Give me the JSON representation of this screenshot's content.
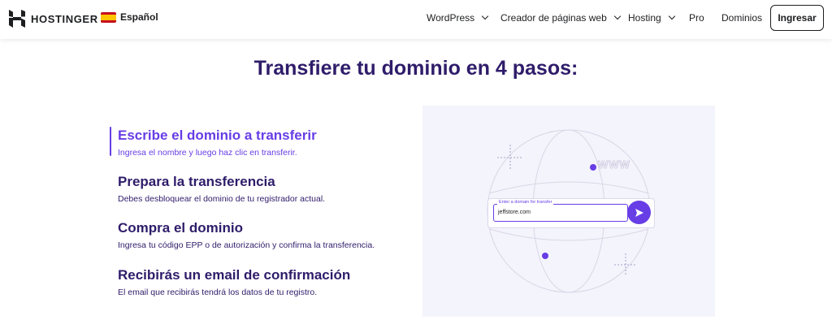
{
  "header": {
    "logo_text": "HOSTINGER",
    "language": "Español",
    "nav": [
      {
        "label": "WordPress",
        "has_dropdown": true
      },
      {
        "label": "Creador de páginas web",
        "has_dropdown": true
      },
      {
        "label": "Hosting",
        "has_dropdown": true
      },
      {
        "label": "Pro",
        "has_dropdown": false
      },
      {
        "label": "Dominios",
        "has_dropdown": false
      }
    ],
    "login_label": "Ingresar"
  },
  "main": {
    "title": "Transfiere tu dominio en 4 pasos:",
    "steps": [
      {
        "title": "Escribe el dominio a transferir",
        "desc": "Ingresa el nombre y luego haz clic en transferir.",
        "active": true
      },
      {
        "title": "Prepara la transferencia",
        "desc": "Debes desbloquear el dominio de tu registrador actual.",
        "active": false
      },
      {
        "title": "Compra el dominio",
        "desc": "Ingresa tu código EPP o de autorización y confirma la transferencia.",
        "active": false
      },
      {
        "title": "Recibirás un email de confirmación",
        "desc": "El email que recibirás tendrá los datos de tu registro.",
        "active": false
      }
    ],
    "illustration": {
      "www_text": "WWW",
      "field_label": "Enter a domain for transfer",
      "field_value": "jeffstore.com"
    }
  },
  "colors": {
    "accent": "#673de6",
    "heading": "#2f1c6a",
    "illustration_bg": "#f4f4fc"
  }
}
